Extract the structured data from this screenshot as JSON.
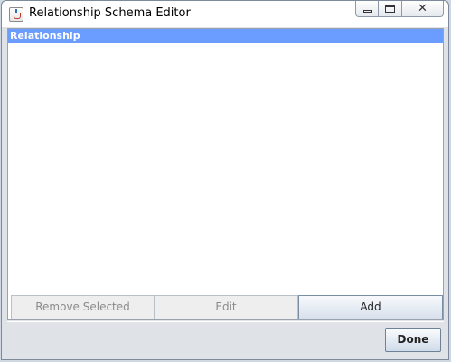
{
  "window": {
    "title": "Relationship Schema Editor"
  },
  "table": {
    "column_header": "Relationship",
    "rows": []
  },
  "buttons": {
    "remove_selected": "Remove Selected",
    "edit": "Edit",
    "add": "Add",
    "done": "Done"
  },
  "colors": {
    "header_bg": "#6b9cff",
    "disabled_text": "#8b8b8b"
  }
}
